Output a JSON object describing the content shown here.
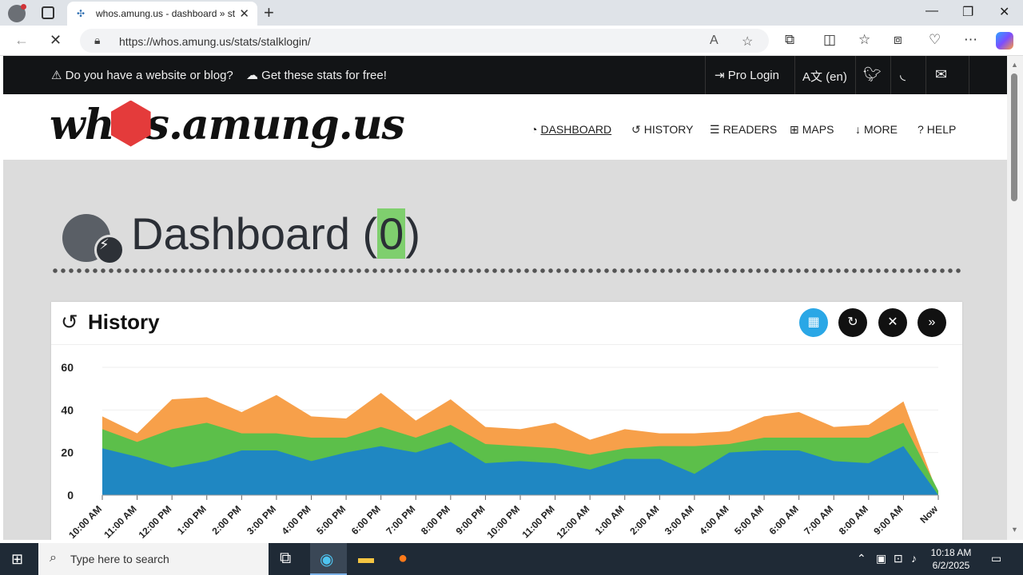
{
  "browser": {
    "tab_title": "whos.amung.us - dashboard » st",
    "url": "https://whos.amung.us/stats/stalklogin/"
  },
  "topstrip": {
    "promo_question": "Do you have a website or blog?",
    "promo_link": "Get these stats for free!",
    "pro_login": "Pro Login",
    "language": "(en)"
  },
  "header": {
    "logo_pre": "wh",
    "logo_post": "s.amung.us",
    "nav": [
      "DASHBOARD",
      "HISTORY",
      "READERS",
      "MAPS",
      "MORE",
      "HELP"
    ]
  },
  "dashboard": {
    "title": "Dashboard (",
    "count": "0",
    "title_close": ")"
  },
  "history": {
    "title": "History"
  },
  "chart_data": {
    "type": "area",
    "ylim": [
      0,
      60
    ],
    "yticks": [
      0,
      20,
      40,
      60
    ],
    "x": [
      "10:00 AM",
      "11:00 AM",
      "12:00 PM",
      "1:00 PM",
      "2:00 PM",
      "3:00 PM",
      "4:00 PM",
      "5:00 PM",
      "6:00 PM",
      "7:00 PM",
      "8:00 PM",
      "9:00 PM",
      "10:00 PM",
      "11:00 PM",
      "12:00 AM",
      "1:00 AM",
      "2:00 AM",
      "3:00 AM",
      "4:00 AM",
      "5:00 AM",
      "6:00 AM",
      "7:00 AM",
      "8:00 AM",
      "9:00 AM",
      "Now"
    ],
    "series": [
      {
        "color": "#1f87c2",
        "values": [
          22,
          18,
          13,
          16,
          21,
          21,
          16,
          20,
          23,
          20,
          25,
          15,
          16,
          15,
          12,
          17,
          17,
          10,
          20,
          21,
          21,
          16,
          15,
          23,
          0
        ]
      },
      {
        "color": "#5cbf4a",
        "values": [
          31,
          25,
          31,
          34,
          29,
          29,
          27,
          27,
          32,
          27,
          33,
          24,
          23,
          22,
          19,
          22,
          23,
          23,
          24,
          27,
          27,
          27,
          27,
          34,
          2
        ]
      },
      {
        "color": "#f7a04a",
        "values": [
          37,
          29,
          45,
          46,
          39,
          47,
          37,
          36,
          48,
          35,
          45,
          32,
          31,
          34,
          26,
          31,
          29,
          29,
          30,
          37,
          39,
          32,
          33,
          44,
          0
        ]
      }
    ]
  },
  "taskbar": {
    "search_placeholder": "Type here to search",
    "time": "10:18 AM",
    "date": "6/2/2025"
  }
}
